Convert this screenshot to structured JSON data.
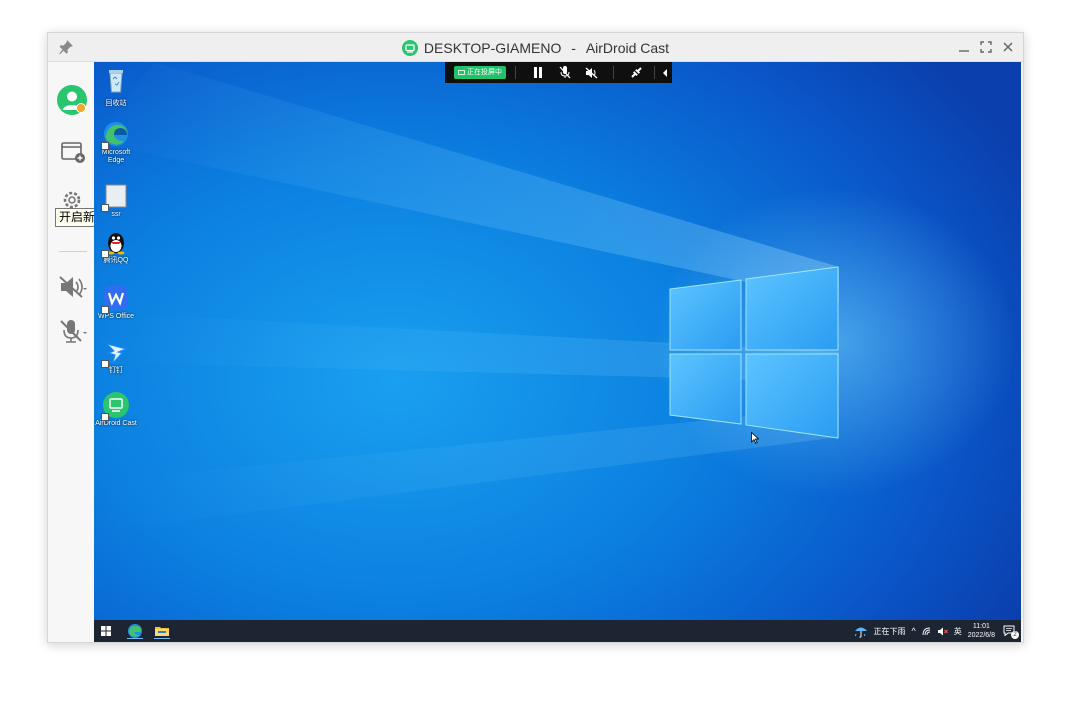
{
  "window": {
    "title_device": "DESKTOP-GIAMENO",
    "title_separator": " - ",
    "title_app": "AirDroid Cast"
  },
  "sidebar": {
    "items": [
      {
        "name": "account-avatar-icon"
      },
      {
        "name": "open-new-window-icon"
      },
      {
        "name": "settings-icon"
      },
      {
        "name": "speaker-muted-icon"
      },
      {
        "name": "mic-muted-icon"
      }
    ],
    "tooltip": "开启新窗口"
  },
  "castbar": {
    "status": "正在投屏中"
  },
  "desktop": {
    "icons": [
      {
        "label": "回收站"
      },
      {
        "label": "Microsoft Edge"
      },
      {
        "label": "ssr"
      },
      {
        "label": "腾讯QQ"
      },
      {
        "label": "WPS Office"
      },
      {
        "label": "钉钉"
      },
      {
        "label": "AirDroid Cast"
      }
    ]
  },
  "taskbar": {
    "weather": "正在下雨",
    "ime": "英",
    "time": "11:01",
    "date": "2022/6/8",
    "notification_count": "2"
  },
  "colors": {
    "accent_green": "#20c26a",
    "taskbar": "#1d2532",
    "desktop_blue": "#0b7fe0"
  }
}
